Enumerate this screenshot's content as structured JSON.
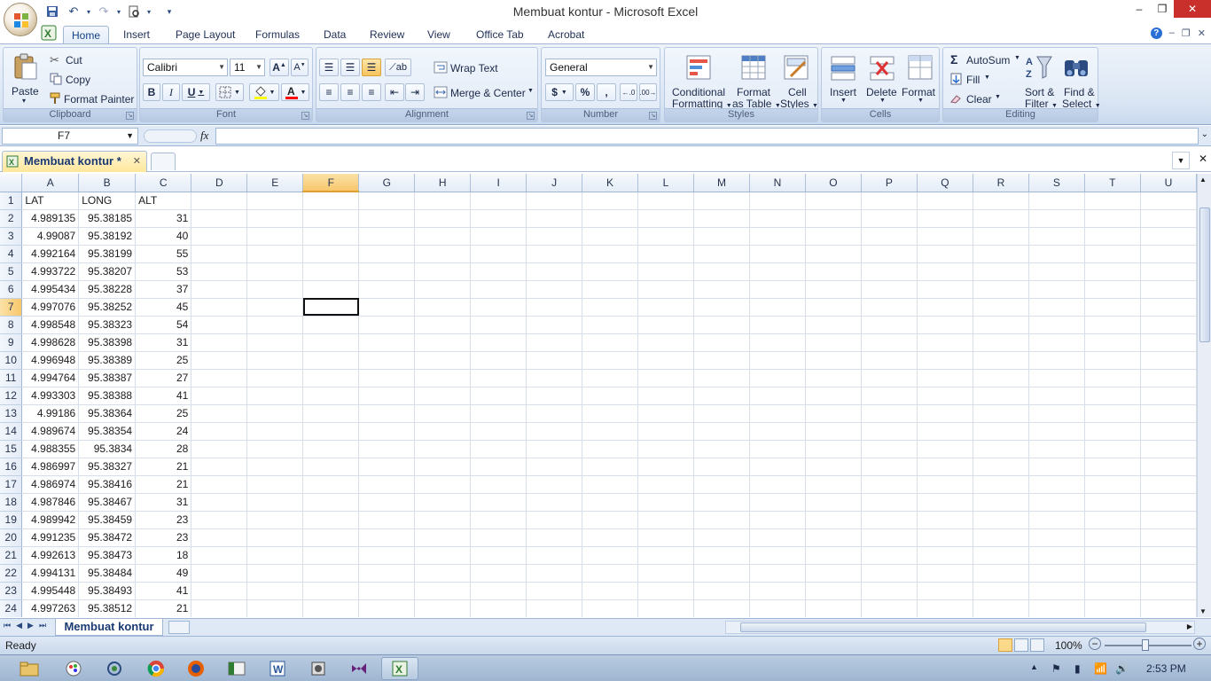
{
  "app": {
    "title": "Membuat kontur - Microsoft Excel",
    "window_controls": {
      "minimize": "–",
      "restore": "❐",
      "close": "✕"
    }
  },
  "ribbon": {
    "tabs": [
      "Home",
      "Insert",
      "Page Layout",
      "Formulas",
      "Data",
      "Review",
      "View",
      "Office Tab",
      "Acrobat"
    ],
    "active_tab": "Home",
    "clipboard": {
      "paste": "Paste",
      "cut": "Cut",
      "copy": "Copy",
      "format_painter": "Format Painter",
      "label": "Clipboard"
    },
    "font": {
      "name": "Calibri",
      "size": "11",
      "bold": "B",
      "italic": "I",
      "underline": "U",
      "label": "Font",
      "fill_color": "#ffff00",
      "font_color": "#ff0000"
    },
    "alignment": {
      "wrap_text": "Wrap Text",
      "merge_center": "Merge & Center",
      "label": "Alignment"
    },
    "number": {
      "format": "General",
      "currency": "$",
      "percent": "%",
      "comma": ",",
      "label": "Number"
    },
    "styles": {
      "conditional": "Conditional",
      "conditional2": "Formatting",
      "format_as": "Format",
      "format_as2": "as Table",
      "cell": "Cell",
      "cell2": "Styles",
      "label": "Styles"
    },
    "cells": {
      "insert": "Insert",
      "delete": "Delete",
      "format": "Format",
      "label": "Cells"
    },
    "editing": {
      "autosum": "AutoSum",
      "fill": "Fill",
      "clear": "Clear",
      "sort": "Sort &",
      "sort2": "Filter",
      "find": "Find &",
      "find2": "Select",
      "label": "Editing"
    }
  },
  "formula_bar": {
    "name_box": "F7",
    "fx": "fx",
    "formula": ""
  },
  "document_tab": {
    "label": "Membuat kontur *",
    "close": "✕"
  },
  "sheet": {
    "columns": [
      "A",
      "B",
      "C",
      "D",
      "E",
      "F",
      "G",
      "H",
      "I",
      "J",
      "K",
      "L",
      "M",
      "N",
      "O",
      "P",
      "Q",
      "R",
      "S",
      "T",
      "U"
    ],
    "selected_column": "F",
    "selected_row": 7,
    "rows": [
      {
        "n": "1",
        "a": "LAT",
        "b": "LONG",
        "c": "ALT"
      },
      {
        "n": "2",
        "a": "4.989135",
        "b": "95.38185",
        "c": "31"
      },
      {
        "n": "3",
        "a": "4.99087",
        "b": "95.38192",
        "c": "40"
      },
      {
        "n": "4",
        "a": "4.992164",
        "b": "95.38199",
        "c": "55"
      },
      {
        "n": "5",
        "a": "4.993722",
        "b": "95.38207",
        "c": "53"
      },
      {
        "n": "6",
        "a": "4.995434",
        "b": "95.38228",
        "c": "37"
      },
      {
        "n": "7",
        "a": "4.997076",
        "b": "95.38252",
        "c": "45"
      },
      {
        "n": "8",
        "a": "4.998548",
        "b": "95.38323",
        "c": "54"
      },
      {
        "n": "9",
        "a": "4.998628",
        "b": "95.38398",
        "c": "31"
      },
      {
        "n": "10",
        "a": "4.996948",
        "b": "95.38389",
        "c": "25"
      },
      {
        "n": "11",
        "a": "4.994764",
        "b": "95.38387",
        "c": "27"
      },
      {
        "n": "12",
        "a": "4.993303",
        "b": "95.38388",
        "c": "41"
      },
      {
        "n": "13",
        "a": "4.99186",
        "b": "95.38364",
        "c": "25"
      },
      {
        "n": "14",
        "a": "4.989674",
        "b": "95.38354",
        "c": "24"
      },
      {
        "n": "15",
        "a": "4.988355",
        "b": "95.3834",
        "c": "28"
      },
      {
        "n": "16",
        "a": "4.986997",
        "b": "95.38327",
        "c": "21"
      },
      {
        "n": "17",
        "a": "4.986974",
        "b": "95.38416",
        "c": "21"
      },
      {
        "n": "18",
        "a": "4.987846",
        "b": "95.38467",
        "c": "31"
      },
      {
        "n": "19",
        "a": "4.989942",
        "b": "95.38459",
        "c": "23"
      },
      {
        "n": "20",
        "a": "4.991235",
        "b": "95.38472",
        "c": "23"
      },
      {
        "n": "21",
        "a": "4.992613",
        "b": "95.38473",
        "c": "18"
      },
      {
        "n": "22",
        "a": "4.994131",
        "b": "95.38484",
        "c": "49"
      },
      {
        "n": "23",
        "a": "4.995448",
        "b": "95.38493",
        "c": "41"
      },
      {
        "n": "24",
        "a": "4.997263",
        "b": "95.38512",
        "c": "21"
      }
    ]
  },
  "sheet_tabs": {
    "active": "Membuat kontur"
  },
  "status": {
    "ready": "Ready",
    "zoom": "100%"
  },
  "taskbar": {
    "clock": "2:53 PM"
  }
}
